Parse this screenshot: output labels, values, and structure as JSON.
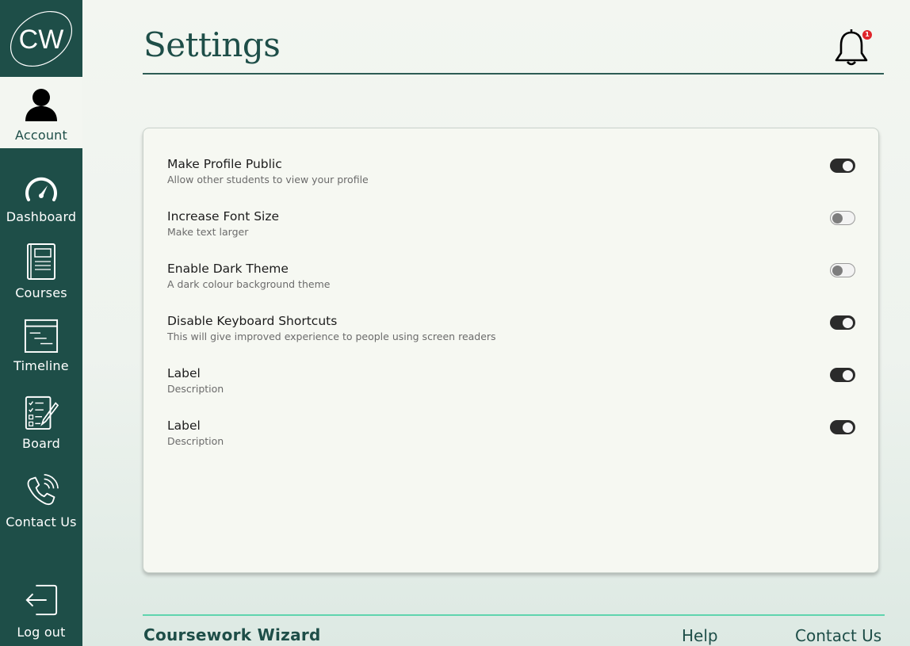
{
  "logo": {
    "text": "CW"
  },
  "sidebar": {
    "items": [
      {
        "label": "Account",
        "icon": "person-icon",
        "active": true
      },
      {
        "label": "Dashboard",
        "icon": "speedometer-icon",
        "active": false
      },
      {
        "label": "Courses",
        "icon": "book-icon",
        "active": false
      },
      {
        "label": "Timeline",
        "icon": "timeline-icon",
        "active": false
      },
      {
        "label": "Board",
        "icon": "checklist-board-icon",
        "active": false
      },
      {
        "label": "Contact Us",
        "icon": "phone-icon",
        "active": false
      }
    ],
    "logout_label": "Log out"
  },
  "header": {
    "title": "Settings",
    "notification_count": "1"
  },
  "settings": [
    {
      "label": "Make Profile Public",
      "description": "Allow other students to view your profile",
      "enabled": true
    },
    {
      "label": "Increase Font Size",
      "description": "Make text larger",
      "enabled": false
    },
    {
      "label": "Enable Dark Theme",
      "description": "A dark colour background theme",
      "enabled": false
    },
    {
      "label": "Disable Keyboard Shortcuts",
      "description": "This will give improved experience to people using screen readers",
      "enabled": true
    },
    {
      "label": "Label",
      "description": "Description",
      "enabled": true
    },
    {
      "label": "Label",
      "description": "Description",
      "enabled": true
    }
  ],
  "footer": {
    "brand": "Coursework Wizard",
    "help_label": "Help",
    "contact_label": "Contact Us"
  },
  "colors": {
    "sidebar": "#1e4e48",
    "accent": "#5fd4ae",
    "badge": "#e0252b"
  }
}
